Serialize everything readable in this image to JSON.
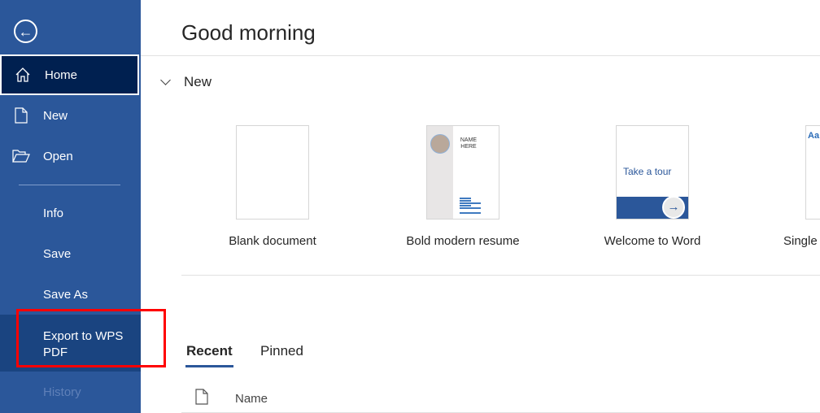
{
  "sidebar": {
    "items": [
      {
        "label": "Home",
        "icon": "home-icon"
      },
      {
        "label": "New",
        "icon": "new-document-icon"
      },
      {
        "label": "Open",
        "icon": "folder-open-icon"
      },
      {
        "label": "Info"
      },
      {
        "label": "Save"
      },
      {
        "label": "Save As"
      },
      {
        "label": "Export to WPS PDF"
      },
      {
        "label": "History"
      }
    ]
  },
  "header": {
    "greeting": "Good morning"
  },
  "new_section": {
    "title": "New",
    "templates": [
      {
        "label": "Blank document"
      },
      {
        "label": "Bold modern resume",
        "thumb_text": "NAME HERE"
      },
      {
        "label": "Welcome to Word",
        "thumb_text": "Take a tour"
      },
      {
        "label": "Single",
        "thumb_text": "Aa"
      }
    ]
  },
  "recent": {
    "tabs": [
      "Recent",
      "Pinned"
    ],
    "column_name": "Name"
  },
  "colors": {
    "sidebar": "#2b579a",
    "selected": "#002050",
    "highlight": "#ff0000"
  }
}
